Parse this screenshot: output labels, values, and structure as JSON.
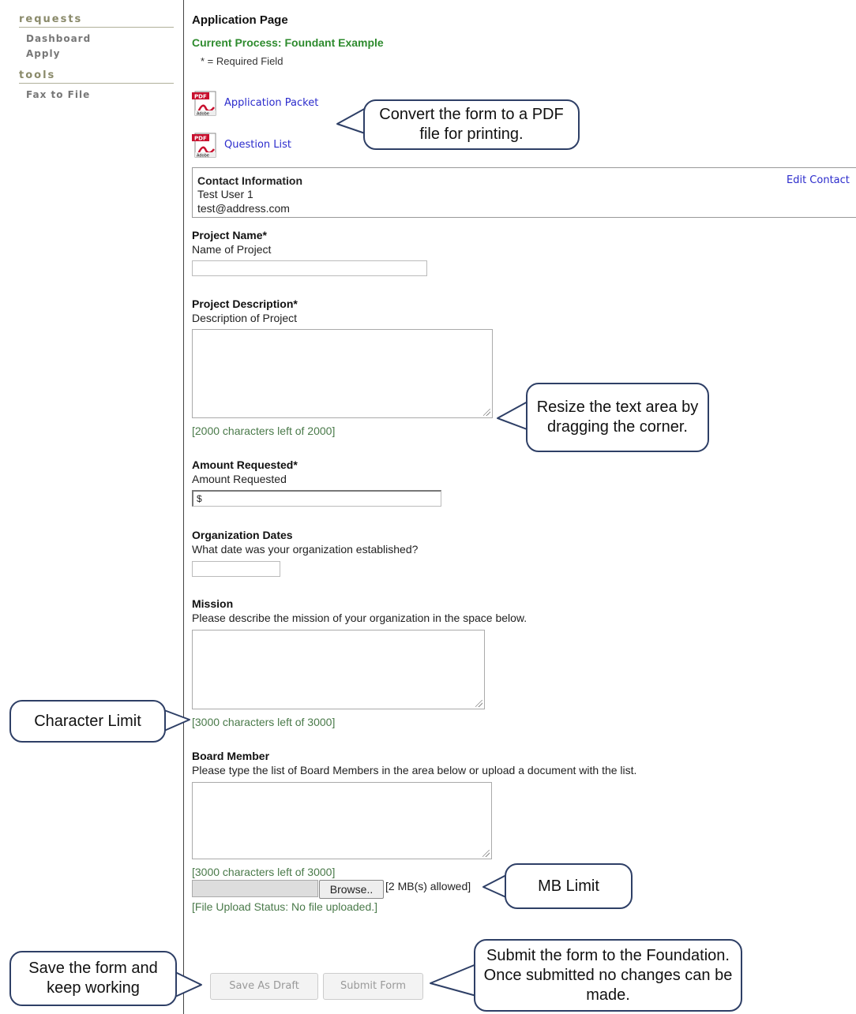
{
  "sidebar": {
    "sections": [
      {
        "heading": "requests",
        "items": [
          "Dashboard",
          "Apply"
        ]
      },
      {
        "heading": "tools",
        "items": [
          "Fax to File"
        ]
      }
    ]
  },
  "page": {
    "title": "Application Page",
    "process": "Current Process: Foundant Example",
    "required_note": "* = Required Field"
  },
  "documents": [
    {
      "label": "Application Packet",
      "icon": "pdf-icon"
    },
    {
      "label": "Question List",
      "icon": "pdf-icon"
    }
  ],
  "contact": {
    "title": "Contact Information",
    "name": "Test User 1",
    "email": "test@address.com",
    "edit_label": "Edit Contact"
  },
  "fields": {
    "project_name": {
      "label": "Project Name*",
      "description": "Name of Project",
      "value": ""
    },
    "project_description": {
      "label": "Project Description*",
      "description": "Description of Project",
      "value": "",
      "counter": "[2000 characters left of 2000]"
    },
    "amount": {
      "label": "Amount Requested*",
      "description": "Amount Requested",
      "value": "$"
    },
    "org_dates": {
      "label": "Organization Dates",
      "description": "What date was your organization established?",
      "value": ""
    },
    "mission": {
      "label": "Mission",
      "description": "Please describe the mission of your organization in the space below.",
      "value": "",
      "counter": "[3000 characters left of 3000]"
    },
    "board": {
      "label": "Board Member",
      "description": "Please type the list of Board Members in the area below or upload a document with the list.",
      "value": "",
      "counter": "[3000 characters left of 3000]",
      "browse_label": "Browse..",
      "size_limit": "[2 MB(s) allowed]",
      "upload_status": "[File Upload Status: No file uploaded.]"
    }
  },
  "actions": {
    "save_draft": "Save As Draft",
    "submit": "Submit Form"
  },
  "callouts": {
    "pdf": "Convert the form to a PDF file for printing.",
    "resize": "Resize the text area by dragging the corner.",
    "char_limit": "Character Limit",
    "mb_limit": "MB Limit",
    "save": "Save the form and keep working",
    "submit": "Submit the form to the Foundation. Once submitted no changes can be made."
  },
  "colors": {
    "process_green": "#2e8b2e",
    "link_blue": "#2b2bcc",
    "callout_border": "#2e3f66",
    "counter_green": "#4a7a4a"
  }
}
